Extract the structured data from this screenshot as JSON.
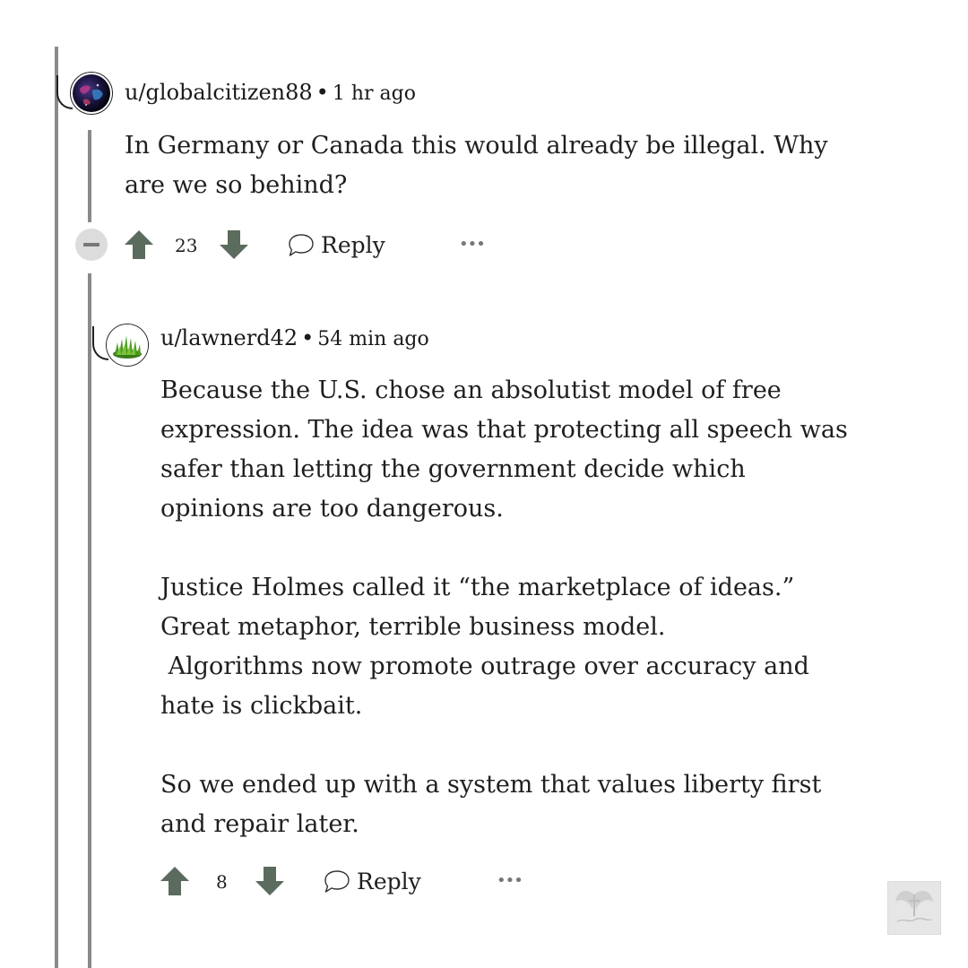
{
  "colors": {
    "vote_arrow": "#5b6b5d",
    "thread_line": "#8a8a8a",
    "collapse_bg": "#dcdcdc"
  },
  "comments": [
    {
      "username": "u/globalcitizen88",
      "separator": "•",
      "time": "1 hr ago",
      "avatar_icon": "globe-avatar",
      "paragraphs": [
        [
          "In Germany or Canada this would already be illegal. Why",
          "are we so behind?"
        ]
      ],
      "votes": "23",
      "reply_label": "Reply",
      "more_icon": "•••"
    },
    {
      "username": "u/lawnerd42",
      "separator": "•",
      "time": "54 min ago",
      "avatar_icon": "grass-avatar",
      "paragraphs": [
        [
          "Because the U.S. chose an absolutist model of free",
          "expression. The idea was that protecting all speech was",
          "safer than letting the government decide which",
          "opinions are too dangerous."
        ],
        [
          "Justice Holmes called it “the marketplace of ideas.”",
          "Great metaphor, terrible business model.",
          " Algorithms now promote outrage over accuracy and",
          "hate is clickbait."
        ],
        [
          "So we ended up with a system that values liberty first",
          "and repair later."
        ]
      ],
      "votes": "8",
      "reply_label": "Reply",
      "more_icon": "•••"
    }
  ]
}
